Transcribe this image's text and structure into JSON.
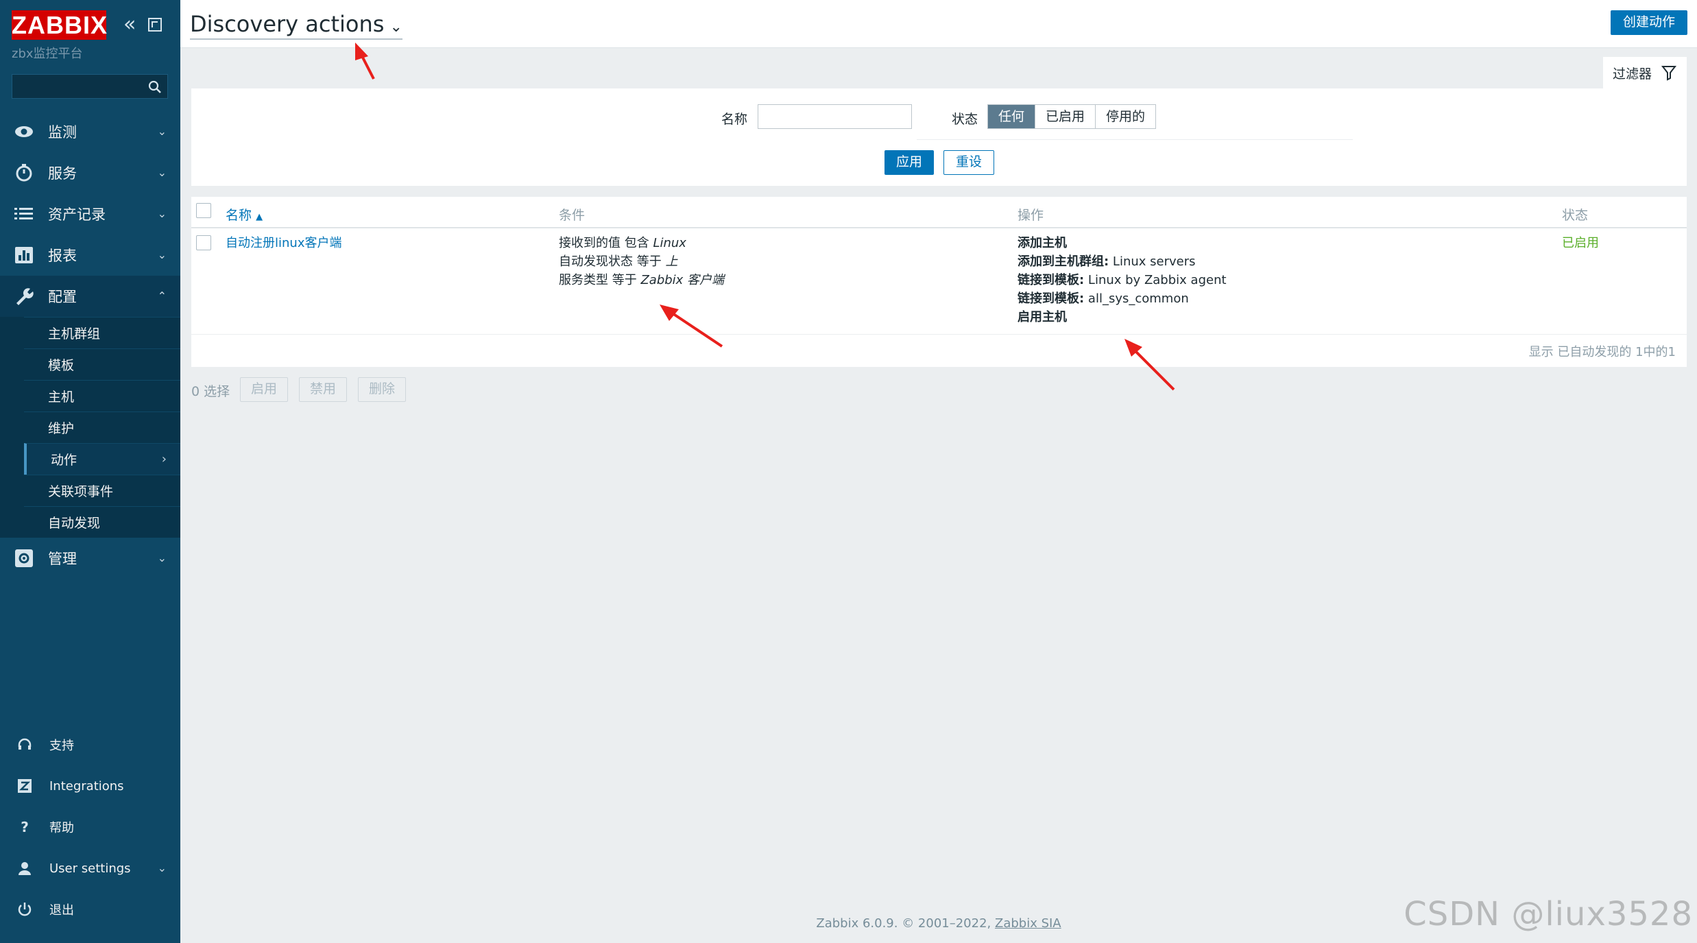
{
  "sidebar": {
    "logo": "ZABBIX",
    "server_name": "zbx监控平台",
    "search_placeholder": "",
    "menu": [
      {
        "label": "监测",
        "icon": "eye-icon"
      },
      {
        "label": "服务",
        "icon": "stopwatch-icon"
      },
      {
        "label": "资产记录",
        "icon": "list-icon"
      },
      {
        "label": "报表",
        "icon": "bar-chart-icon"
      },
      {
        "label": "配置",
        "icon": "wrench-icon"
      }
    ],
    "config_submenu": [
      "主机群组",
      "模板",
      "主机",
      "维护",
      "动作",
      "关联项事件",
      "自动发现"
    ],
    "admin": {
      "label": "管理",
      "icon": "gear-icon"
    },
    "bottom": [
      {
        "label": "支持",
        "icon": "headset-icon"
      },
      {
        "label": "Integrations",
        "icon": "z-icon"
      },
      {
        "label": "帮助",
        "icon": "question-icon"
      },
      {
        "label": "User settings",
        "icon": "user-icon"
      },
      {
        "label": "退出",
        "icon": "power-icon"
      }
    ]
  },
  "header": {
    "title": "Discovery actions",
    "create_button": "创建动作"
  },
  "filter": {
    "tab_label": "过滤器",
    "name_label": "名称",
    "name_value": "",
    "status_label": "状态",
    "status_options": [
      "任何",
      "已启用",
      "停用的"
    ],
    "status_selected": "任何",
    "apply": "应用",
    "reset": "重设"
  },
  "table": {
    "columns": {
      "name": "名称",
      "conditions": "条件",
      "operations": "操作",
      "status": "状态"
    },
    "sort_indicator": "▲",
    "rows": [
      {
        "name": "自动注册linux客户端",
        "conditions": [
          {
            "text": "接收到的值 包含 ",
            "value": "Linux"
          },
          {
            "text": "自动发现状态 等于 ",
            "value": "上"
          },
          {
            "text": "服务类型 等于 ",
            "value": "Zabbix 客户端"
          }
        ],
        "operations": [
          {
            "key": "添加主机",
            "value": ""
          },
          {
            "key": "添加到主机群组:",
            "value": " Linux servers"
          },
          {
            "key": "链接到模板:",
            "value": " Linux by Zabbix agent"
          },
          {
            "key": "链接到模板:",
            "value": " all_sys_common"
          },
          {
            "key": "启用主机",
            "value": ""
          }
        ],
        "status": "已启用"
      }
    ],
    "paging": "显示 已自动发现的 1中的1"
  },
  "bulk": {
    "selected": "0 选择",
    "enable": "启用",
    "disable": "禁用",
    "delete": "删除"
  },
  "footer": {
    "text": "Zabbix 6.0.9. © 2001–2022, ",
    "link": "Zabbix SIA"
  },
  "watermark": "CSDN @liux3528",
  "colors": {
    "sidebar": "#0e4866",
    "accent": "#0275b8",
    "logo": "#d40000",
    "enabled": "#59ae28",
    "annotation": "#e8201c"
  }
}
